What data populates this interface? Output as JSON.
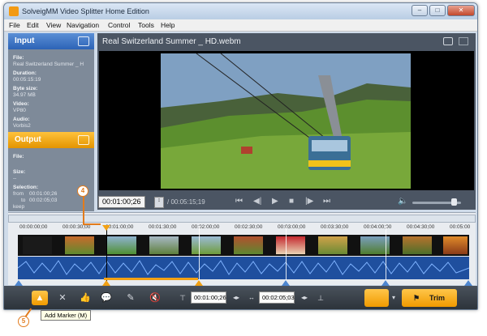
{
  "window": {
    "title": "SolveigMM Video Splitter Home Edition",
    "controls": [
      "–",
      "□",
      "✕"
    ]
  },
  "menu": [
    "File",
    "Edit",
    "View",
    "Navigation",
    "Control",
    "Tools",
    "Help"
  ],
  "input_panel": {
    "heading": "Input",
    "fields": [
      {
        "label": "File:",
        "value": "Real Switzerland Summer _ H"
      },
      {
        "label": "Duration:",
        "value": "00:05:15:19"
      },
      {
        "label": "Byte size:",
        "value": "34.97 MB"
      },
      {
        "label": "Video:",
        "value": "VP80"
      },
      {
        "label": "Audio:",
        "value": "Vorbis2"
      }
    ]
  },
  "output_panel": {
    "heading": "Output",
    "file_label": "File:",
    "size_label": "Size:",
    "size_value": "--",
    "selection_label": "Selection:",
    "selection_from_label": "from",
    "selection_from": "00:01:00;26",
    "selection_to_label": "to",
    "selection_to": "00:02:05;03",
    "selection_mode": "keep"
  },
  "player": {
    "file_title": "Real Switzerland Summer _ HD.webm",
    "current_time": "00:01:00;26",
    "total_time": "/ 00:05:15;19",
    "volume_level": 0.78
  },
  "timeline": {
    "ticks": [
      "00:00:00;00",
      "00:00:30;00",
      "00:01:00;00",
      "00:01:30;00",
      "00:02:00;00",
      "00:02:30;00",
      "00:03:00;00",
      "00:03:30;00",
      "00:04:00;00",
      "00:04:30;00",
      "00:05:00"
    ]
  },
  "toolbar": {
    "from_time": "00:01:00;26",
    "to_time": "00:02:05;03",
    "trim_label": "Trim"
  },
  "tooltip": "Add Marker (M)",
  "callouts": {
    "a": "4",
    "b": "5"
  },
  "colors": {
    "accent_orange": "#f29a14",
    "input_blue": "#2c63b6",
    "marker_blue": "#4e86cf"
  }
}
